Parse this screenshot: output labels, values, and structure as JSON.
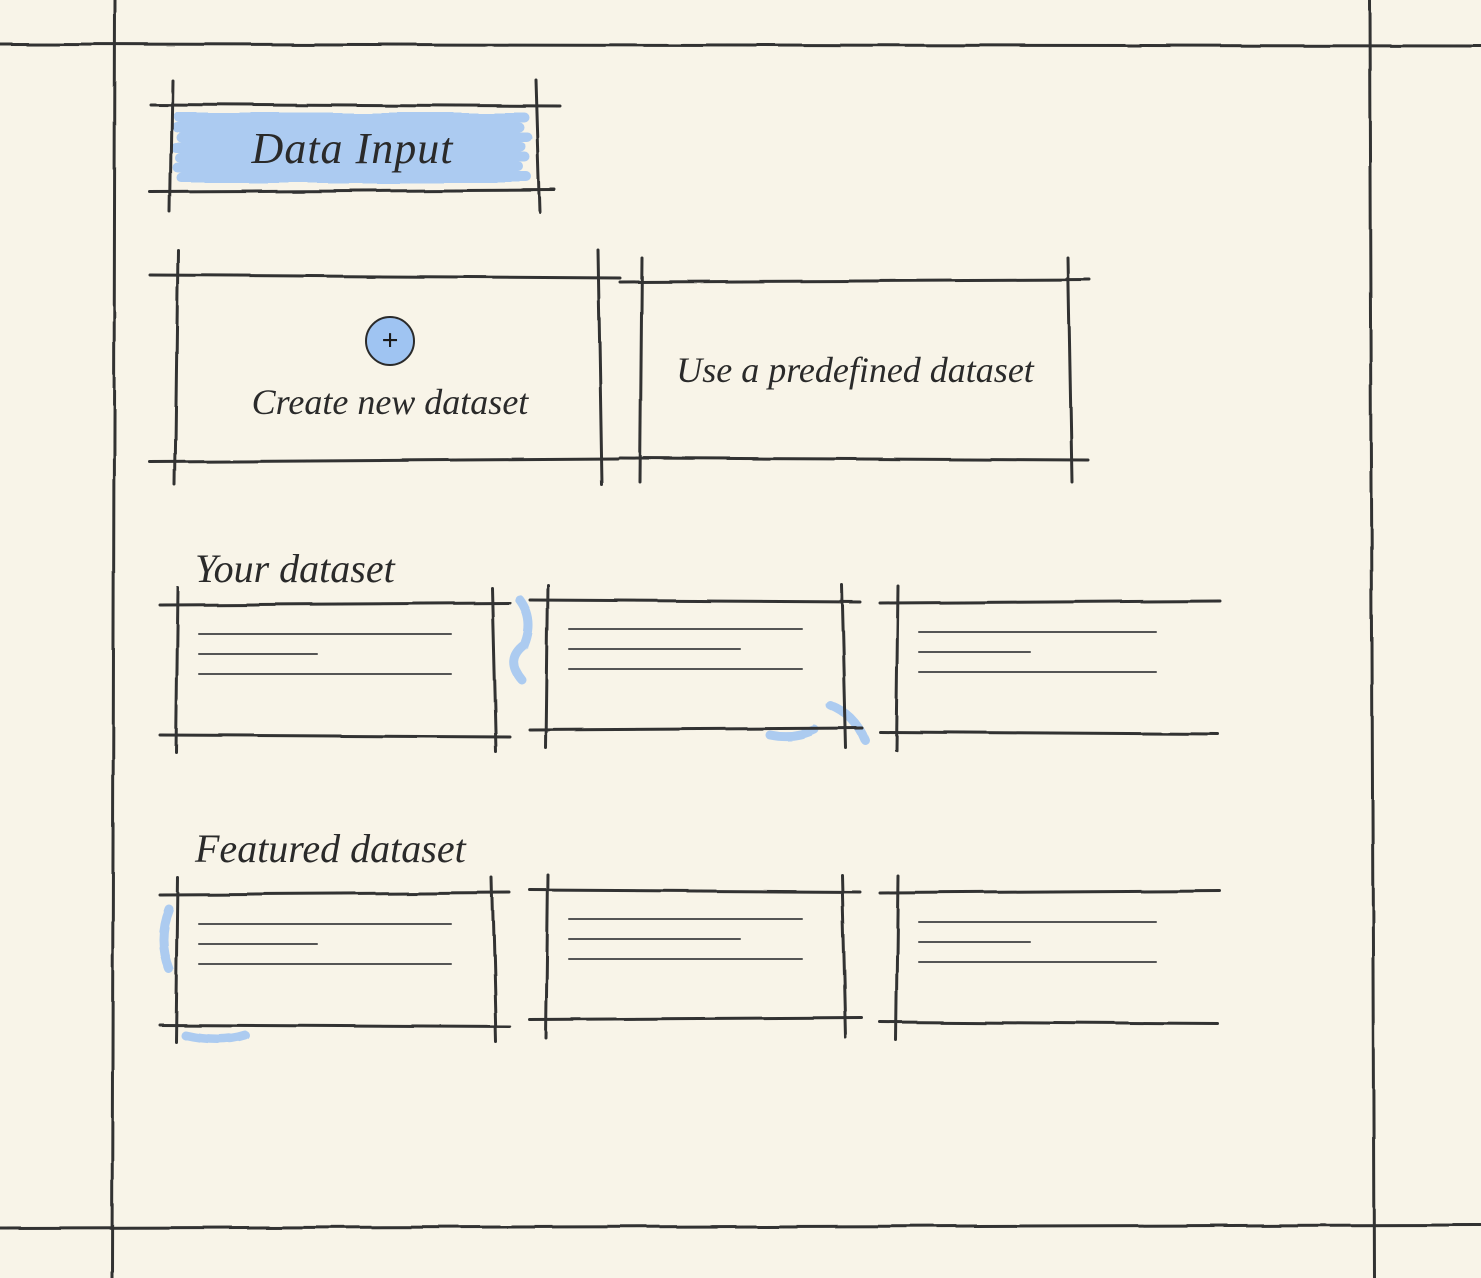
{
  "page_title": "Data Input",
  "option_cards": {
    "create": {
      "label": "Create new dataset",
      "icon": "plus"
    },
    "predefined": {
      "label": "Use a predefined dataset"
    }
  },
  "sections": {
    "your_datasets": {
      "heading": "Your dataset",
      "items": [
        {
          "placeholder": true
        },
        {
          "placeholder": true
        },
        {
          "placeholder": true
        }
      ]
    },
    "featured_datasets": {
      "heading": "Featured dataset",
      "items": [
        {
          "placeholder": true
        },
        {
          "placeholder": true
        },
        {
          "placeholder": true
        }
      ]
    }
  },
  "colors": {
    "accent": "#9fc4f2",
    "ink": "#2a2a2a",
    "paper": "#f8f4e8"
  }
}
